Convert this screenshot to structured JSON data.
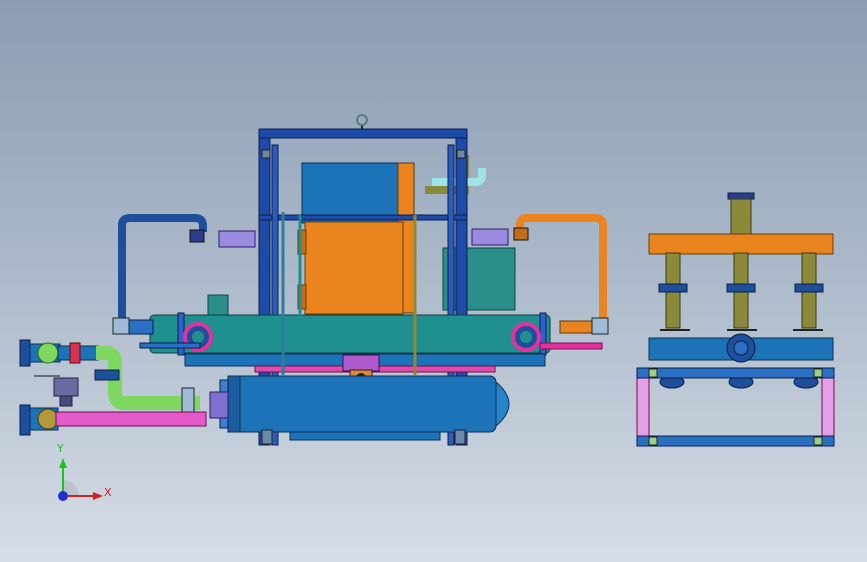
{
  "view": {
    "background_top": "#8b9db4",
    "background_bottom": "#d6dde6"
  },
  "triad": {
    "y_label": "Y",
    "x_label": "X",
    "y_color": "#1fc21f",
    "x_color": "#d61f1f",
    "z_color": "#1f2fd6"
  },
  "colors": {
    "frame": "#1e4aa8",
    "frame_dark": "#12307a",
    "steel_blue": "#1d73b8",
    "orange": "#e9841e",
    "teal": "#1f8f8f",
    "pipe_green": "#7fd860",
    "pipe_magenta": "#e35ac8",
    "lavender": "#9b8be0",
    "olive": "#8a8a3a",
    "light_cyan": "#9fe3e6"
  },
  "components": [
    "main-frame",
    "control-cabinet",
    "upper-shell",
    "lower-shell",
    "left-piping",
    "right-piping",
    "side-view-assembly"
  ]
}
